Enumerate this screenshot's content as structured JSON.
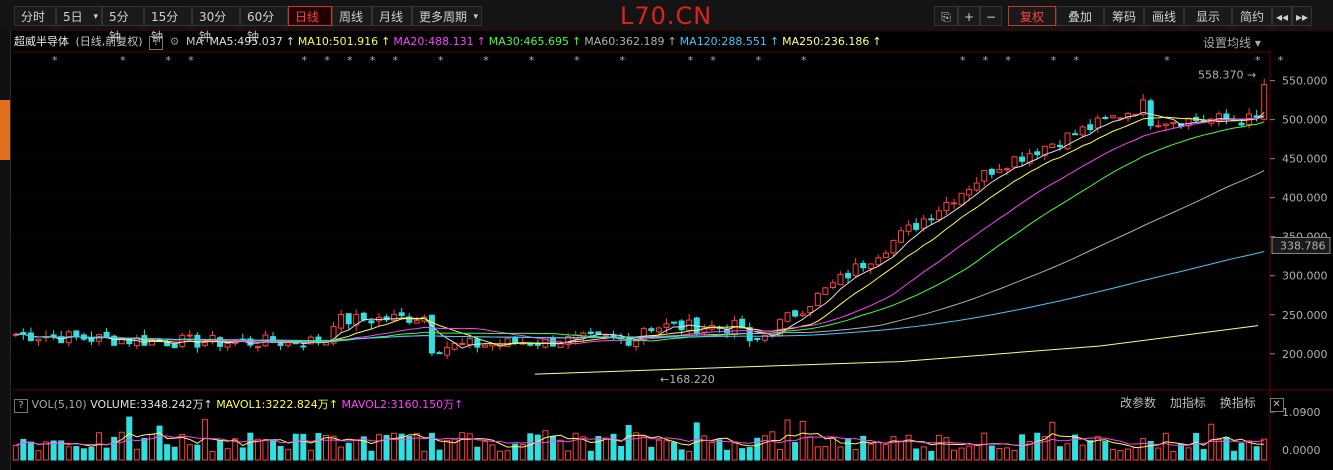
{
  "toolbar": {
    "tabs": [
      {
        "label": "分时",
        "active": false
      },
      {
        "label": "5日",
        "active": false,
        "dropdown": true
      },
      {
        "label": "5分钟",
        "active": false
      },
      {
        "label": "15分钟",
        "active": false
      },
      {
        "label": "30分钟",
        "active": false
      },
      {
        "label": "60分钟",
        "active": false
      },
      {
        "label": "日线",
        "active": true
      },
      {
        "label": "周线",
        "active": false
      },
      {
        "label": "月线",
        "active": false
      },
      {
        "label": "更多周期",
        "active": false,
        "dropdown": true
      }
    ],
    "brand": "L70.CN",
    "right_buttons": [
      {
        "label": "⎘",
        "icon": "lock-icon"
      },
      {
        "label": "+",
        "icon": "zoom-in-icon"
      },
      {
        "label": "−",
        "icon": "zoom-out-icon"
      },
      {
        "label": "复权",
        "active": true,
        "dropdown": true
      },
      {
        "label": "叠加",
        "dropdown": true
      },
      {
        "label": "筹码"
      },
      {
        "label": "画线"
      },
      {
        "label": "显示",
        "dropdown": true
      },
      {
        "label": "简约"
      },
      {
        "label": "◂◂",
        "icon": "rewind-icon"
      },
      {
        "label": "▸▸",
        "icon": "fast-forward-icon"
      }
    ]
  },
  "legend": {
    "title": "超威半导体",
    "subtitle": "(日线,前复权)",
    "help": "?",
    "ma_label": "MA",
    "items": [
      {
        "text": "MA5:495.037",
        "color": "#e0e0e0"
      },
      {
        "text": "MA10:501.916",
        "color": "#ffff40"
      },
      {
        "text": "MA20:488.131",
        "color": "#ff40ff"
      },
      {
        "text": "MA30:465.695",
        "color": "#40ff40"
      },
      {
        "text": "MA60:362.189",
        "color": "#b0b0b0"
      },
      {
        "text": "MA120:288.551",
        "color": "#40c8ff"
      },
      {
        "text": "MA250:236.186",
        "color": "#ffff80"
      }
    ],
    "settings": "设置均线"
  },
  "price_axis": {
    "ticks": [
      "550.000",
      "500.000",
      "450.000",
      "400.000",
      "350.000",
      "300.000",
      "250.000",
      "200.000"
    ],
    "tick_values": [
      550,
      500,
      450,
      400,
      350,
      300,
      250,
      200
    ],
    "current_label": "338.786",
    "current_value": 338.786
  },
  "annotations": {
    "high": "558.370",
    "low": "168.220"
  },
  "volume": {
    "legend_prefix": "VOL(5,10)",
    "volume": "VOLUME:3348.242万",
    "mavol1": "MAVOL1:3222.824万",
    "mavol2": "MAVOL2:3160.150万",
    "tools": [
      "改参数",
      "加指标",
      "换指标"
    ],
    "close": "✕",
    "axis": [
      "1.0900",
      "0.0000"
    ]
  },
  "colors": {
    "up": "#ff4040",
    "down": "#30e0e0",
    "bg": "#000000",
    "grid": "#3a0000"
  },
  "chart_data": {
    "type": "candlestick",
    "ylim": [
      160,
      570
    ],
    "high": 558.37,
    "low": 168.22,
    "ma_values": {
      "MA5": 495.037,
      "MA10": 501.916,
      "MA20": 488.131,
      "MA30": 465.695,
      "MA60": 362.189,
      "MA120": 288.551,
      "MA250": 236.186
    }
  }
}
